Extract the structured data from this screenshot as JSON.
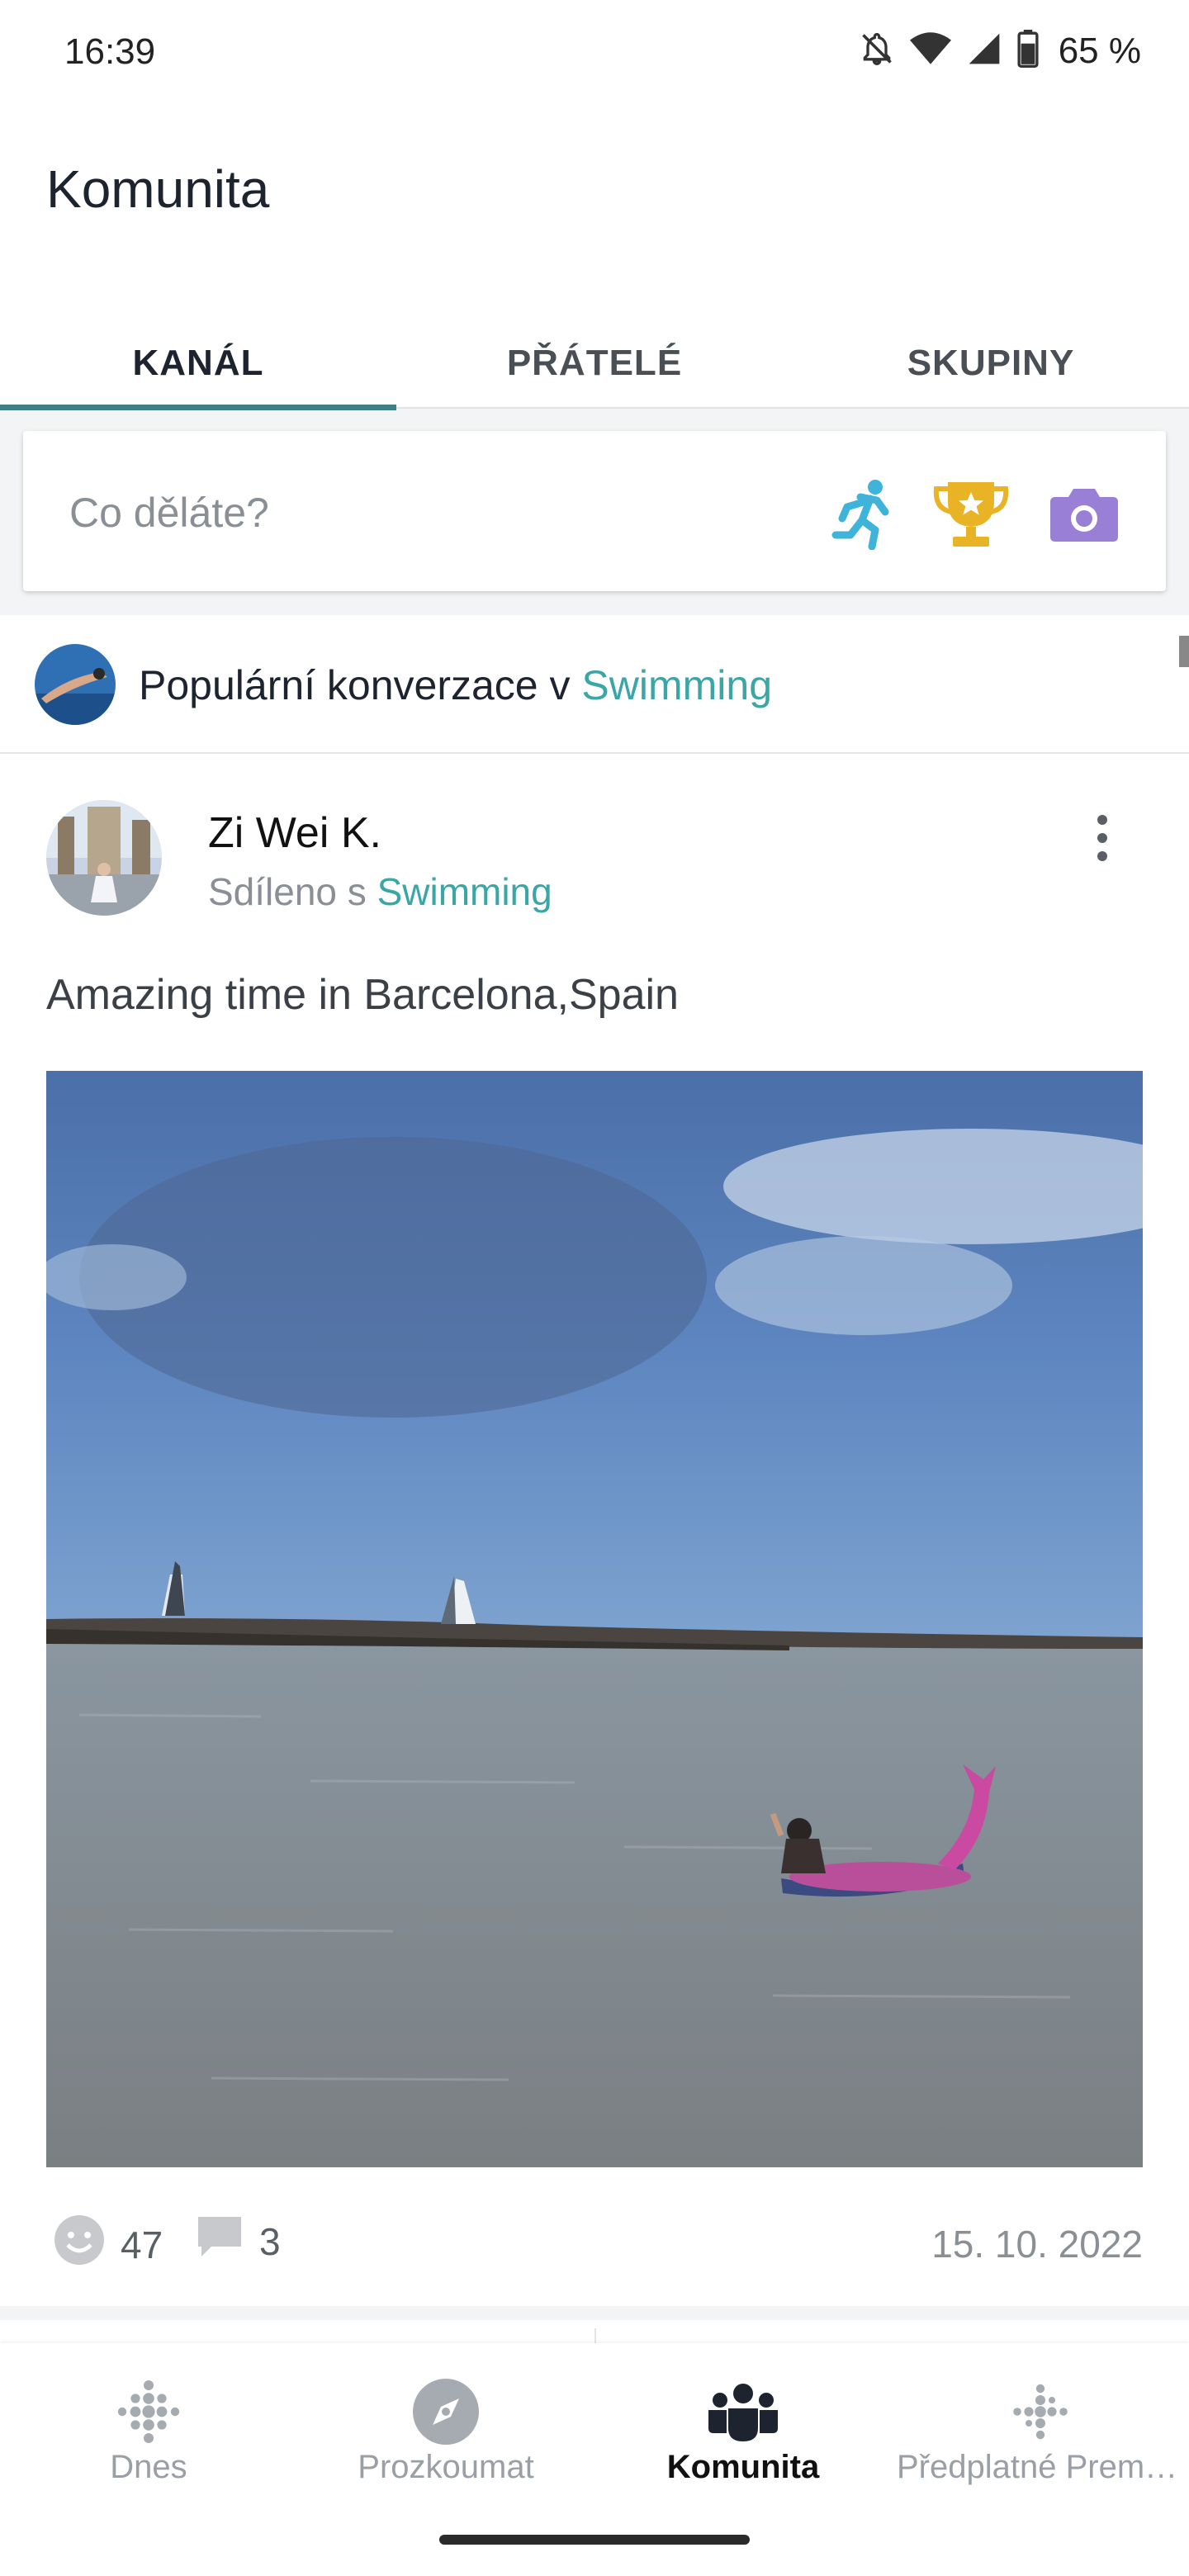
{
  "status_bar": {
    "time": "16:39",
    "battery_pct": "65 %"
  },
  "header": {
    "title": "Komunita",
    "tabs": [
      {
        "label": "KANÁL",
        "active": true
      },
      {
        "label": "PŘÁTELÉ",
        "active": false
      },
      {
        "label": "SKUPINY",
        "active": false
      }
    ]
  },
  "composer": {
    "placeholder": "Co děláte?",
    "icons": [
      "activity-runner-icon",
      "trophy-icon",
      "camera-icon"
    ]
  },
  "popular": {
    "prefix": "Populární konverzace v ",
    "group": "Swimming"
  },
  "post": {
    "author": "Zi Wei K.",
    "shared_prefix": "Sdíleno s ",
    "shared_group": "Swimming",
    "text": "Amazing time in Barcelona,Spain",
    "reactions": "47",
    "comments": "3",
    "date": "15. 10. 2022"
  },
  "bottom_nav": [
    {
      "label": "Dnes",
      "icon": "dots-logo-icon",
      "active": false
    },
    {
      "label": "Prozkoumat",
      "icon": "compass-icon",
      "active": false
    },
    {
      "label": "Komunita",
      "icon": "community-icon",
      "active": true
    },
    {
      "label": "Předplatné Premi…",
      "icon": "premium-dots-icon",
      "active": false
    }
  ],
  "colors": {
    "accent": "#3e7e87",
    "link": "#3aa6a6",
    "runner": "#3fb3d9",
    "trophy": "#e8b325",
    "camera": "#9a7fd6"
  }
}
